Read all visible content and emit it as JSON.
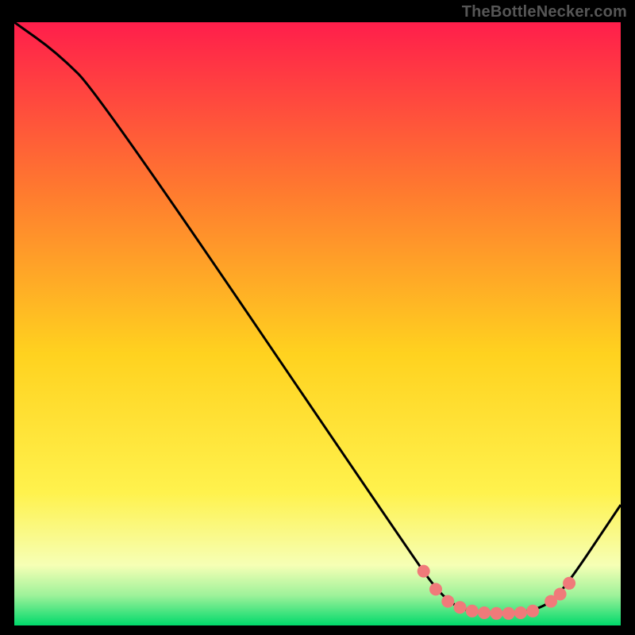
{
  "attribution": "TheBottleNecker.com",
  "chart_data": {
    "type": "line",
    "title": "",
    "xlabel": "",
    "ylabel": "",
    "xlim": [
      0,
      100
    ],
    "ylim": [
      0,
      100
    ],
    "grid": false,
    "legend": false,
    "series": [
      {
        "name": "curve",
        "points": [
          {
            "x": 0,
            "y": 100
          },
          {
            "x": 7,
            "y": 95
          },
          {
            "x": 14,
            "y": 88
          },
          {
            "x": 66,
            "y": 11
          },
          {
            "x": 70,
            "y": 5.5
          },
          {
            "x": 73,
            "y": 3
          },
          {
            "x": 76,
            "y": 2.2
          },
          {
            "x": 80,
            "y": 2
          },
          {
            "x": 84,
            "y": 2.2
          },
          {
            "x": 87,
            "y": 3
          },
          {
            "x": 90,
            "y": 5
          },
          {
            "x": 100,
            "y": 20
          }
        ]
      }
    ],
    "markers": [
      {
        "x": 67.5,
        "y": 9.0
      },
      {
        "x": 69.5,
        "y": 6.0
      },
      {
        "x": 71.5,
        "y": 4.0
      },
      {
        "x": 73.5,
        "y": 3.0
      },
      {
        "x": 75.5,
        "y": 2.4
      },
      {
        "x": 77.5,
        "y": 2.1
      },
      {
        "x": 79.5,
        "y": 2.0
      },
      {
        "x": 81.5,
        "y": 2.0
      },
      {
        "x": 83.5,
        "y": 2.1
      },
      {
        "x": 85.5,
        "y": 2.4
      },
      {
        "x": 88.5,
        "y": 4.0
      },
      {
        "x": 90.0,
        "y": 5.2
      },
      {
        "x": 91.5,
        "y": 7.0
      }
    ],
    "colors": {
      "gradient_top": "#ff1e4b",
      "gradient_mid_upper": "#ff7a2f",
      "gradient_mid": "#ffd21f",
      "gradient_mid_lower": "#fff24d",
      "gradient_low": "#f6ffb5",
      "gradient_band": "#9ef29a",
      "gradient_bottom": "#00d96b",
      "curve": "#000000",
      "marker": "#f07a7a"
    }
  }
}
